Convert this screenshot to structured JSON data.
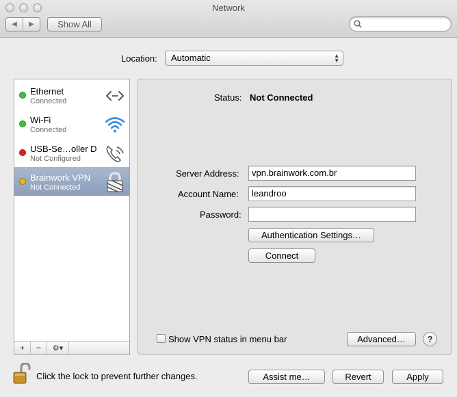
{
  "window": {
    "title": "Network"
  },
  "toolbar": {
    "show_all_label": "Show All",
    "search_placeholder": ""
  },
  "location": {
    "label": "Location:",
    "value": "Automatic"
  },
  "sidebar": {
    "items": [
      {
        "name": "Ethernet",
        "status": "Connected",
        "status_color": "#3fc03a",
        "icon": "ethernet-icon"
      },
      {
        "name": "Wi-Fi",
        "status": "Connected",
        "status_color": "#3fc03a",
        "icon": "wifi-icon"
      },
      {
        "name": "USB-Se…oller D",
        "status": "Not Configured",
        "status_color": "#d9251d",
        "icon": "phone-modem-icon"
      },
      {
        "name": "Brainwork VPN",
        "status": "Not Connected",
        "status_color": "#e8b716",
        "icon": "vpn-lock-icon"
      }
    ],
    "footer": {
      "add": "+",
      "remove": "−",
      "gear": "⚙▾"
    }
  },
  "detail": {
    "status_label": "Status:",
    "status_value": "Not Connected",
    "server_address_label": "Server Address:",
    "server_address_value": "vpn.brainwork.com.br",
    "account_name_label": "Account Name:",
    "account_name_value": "leandroo",
    "password_label": "Password:",
    "password_value": "",
    "auth_settings_label": "Authentication Settings…",
    "connect_label": "Connect",
    "show_vpn_status_label": "Show VPN status in menu bar",
    "show_vpn_status_checked": false,
    "advanced_label": "Advanced…",
    "help_label": "?"
  },
  "bottom": {
    "lock_text": "Click the lock to prevent further changes.",
    "assist_label": "Assist me…",
    "revert_label": "Revert",
    "apply_label": "Apply"
  },
  "colors": {
    "selection": "#9aabc6",
    "panel_bg": "#e3e3e3"
  }
}
